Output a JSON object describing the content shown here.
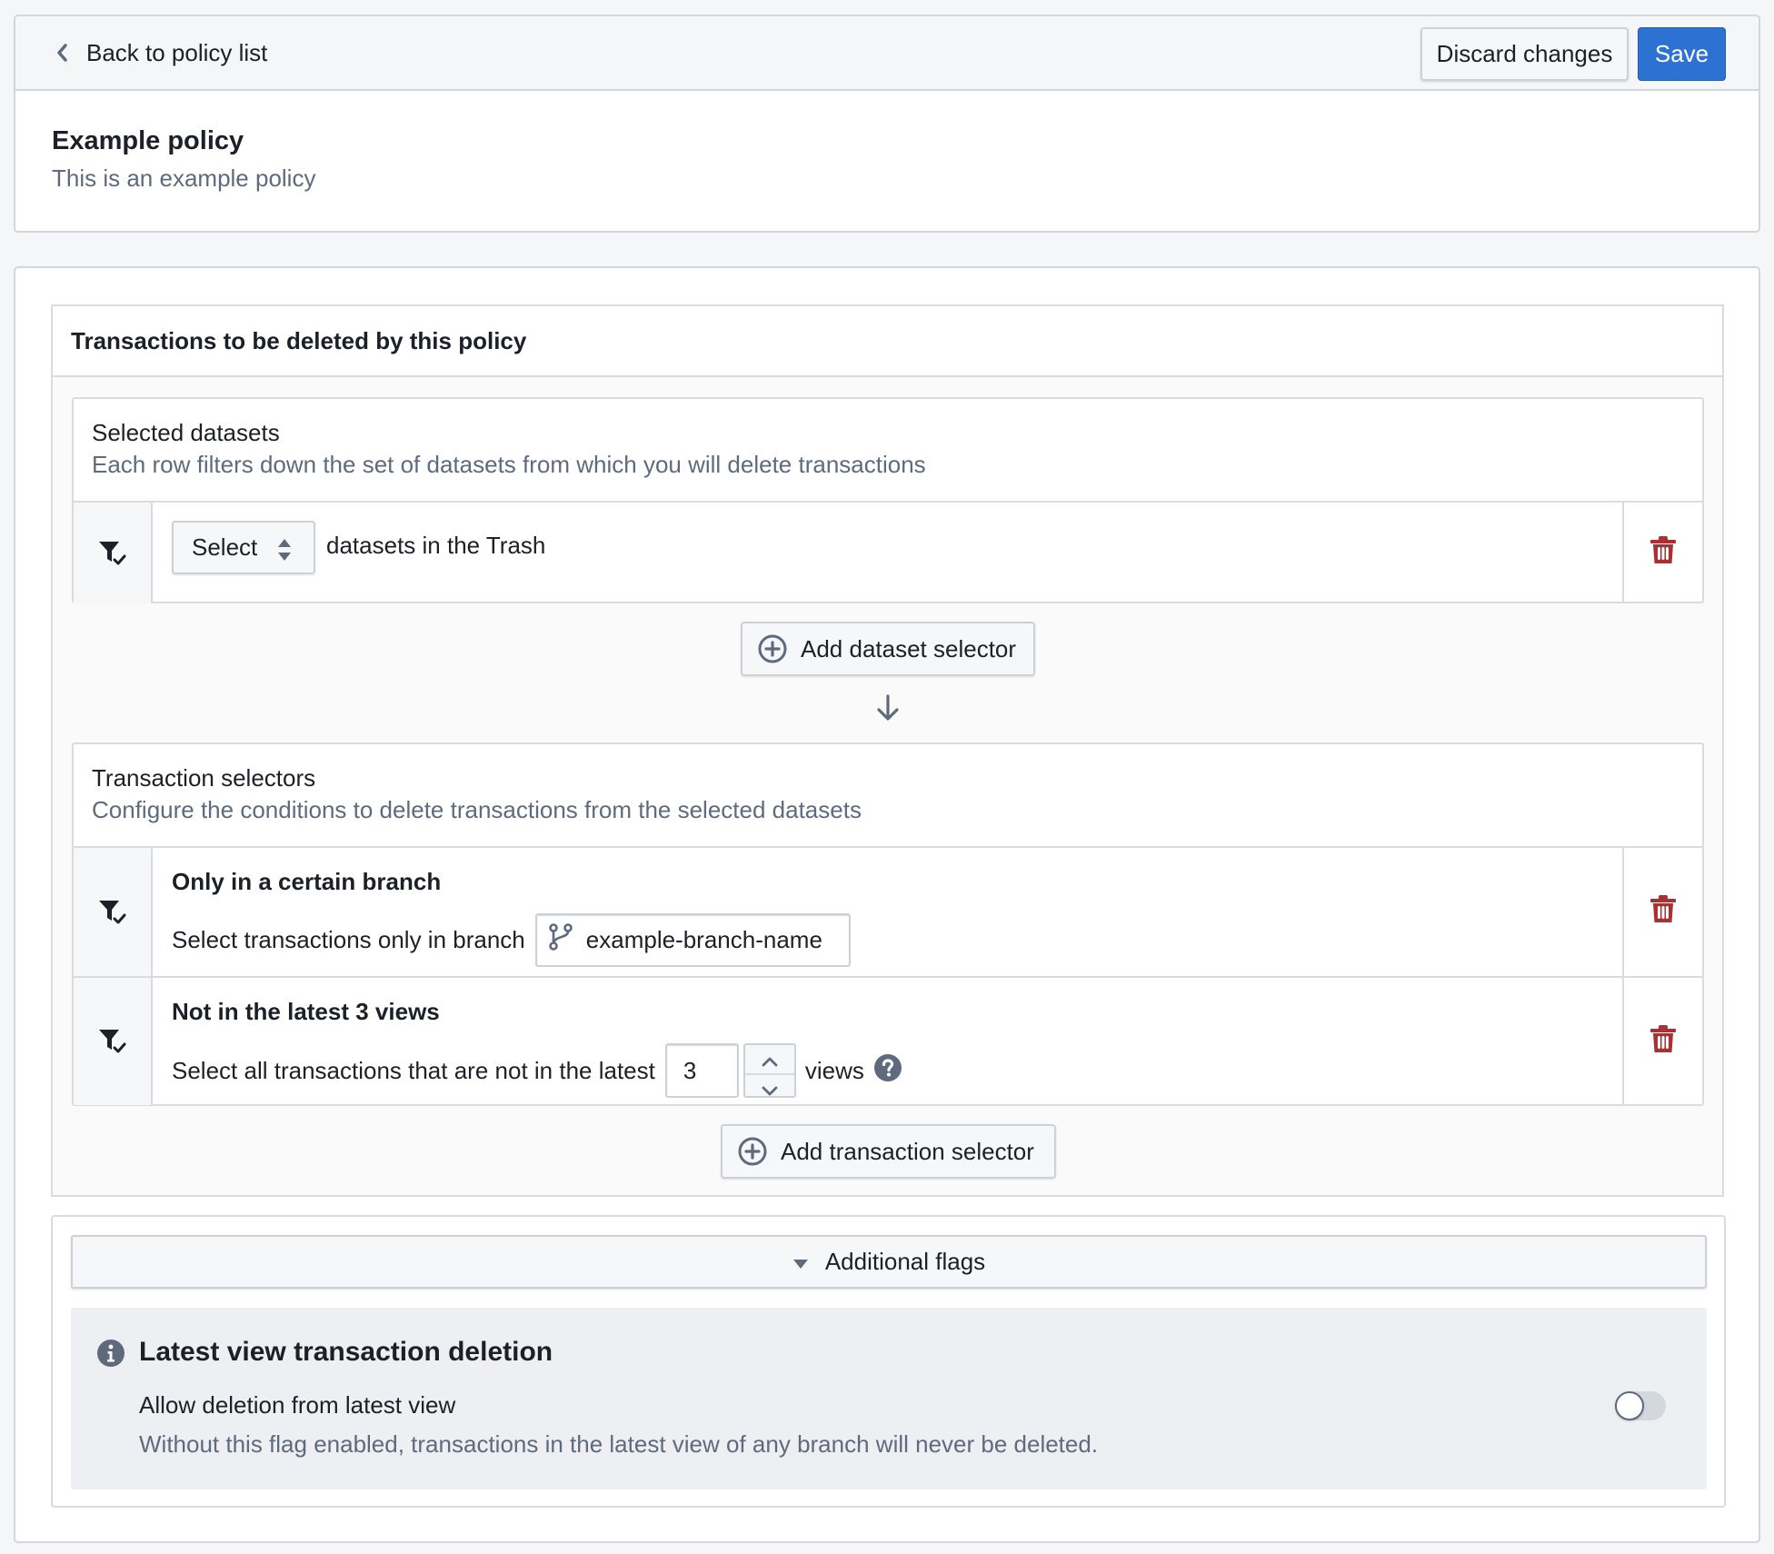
{
  "header": {
    "back_label": "Back to policy list",
    "discard_label": "Discard changes",
    "save_label": "Save",
    "policy_title": "Example policy",
    "policy_description": "This is an example policy"
  },
  "transactions_section": {
    "title": "Transactions to be deleted by this policy",
    "selected_datasets": {
      "title": "Selected datasets",
      "description": "Each row filters down the set of datasets from which you will delete transactions",
      "rows": [
        {
          "select_value": "Select",
          "suffix_text": "datasets in the Trash"
        }
      ],
      "add_label": "Add dataset selector"
    },
    "transaction_selectors": {
      "title": "Transaction selectors",
      "description": "Configure the conditions to delete transactions from the selected datasets",
      "rows": [
        {
          "title": "Only in a certain branch",
          "prefix_text": "Select transactions only in branch",
          "branch_value": "example-branch-name"
        },
        {
          "title": "Not in the latest 3 views",
          "prefix_text": "Select all transactions that are not in the latest",
          "views_value": "3",
          "suffix_text": "views"
        }
      ],
      "add_label": "Add transaction selector"
    }
  },
  "flags": {
    "toggle_label": "Additional flags",
    "expanded": true,
    "items": [
      {
        "title": "Latest view transaction deletion",
        "label": "Allow deletion from latest view",
        "description": "Without this flag enabled, transactions in the latest view of any branch will never be deleted.",
        "enabled": false
      }
    ]
  },
  "colors": {
    "primary": "#2d72d2",
    "danger": "#ac2f33",
    "muted_text": "#5f6b7c",
    "icon_gray": "#5f6b7c"
  }
}
